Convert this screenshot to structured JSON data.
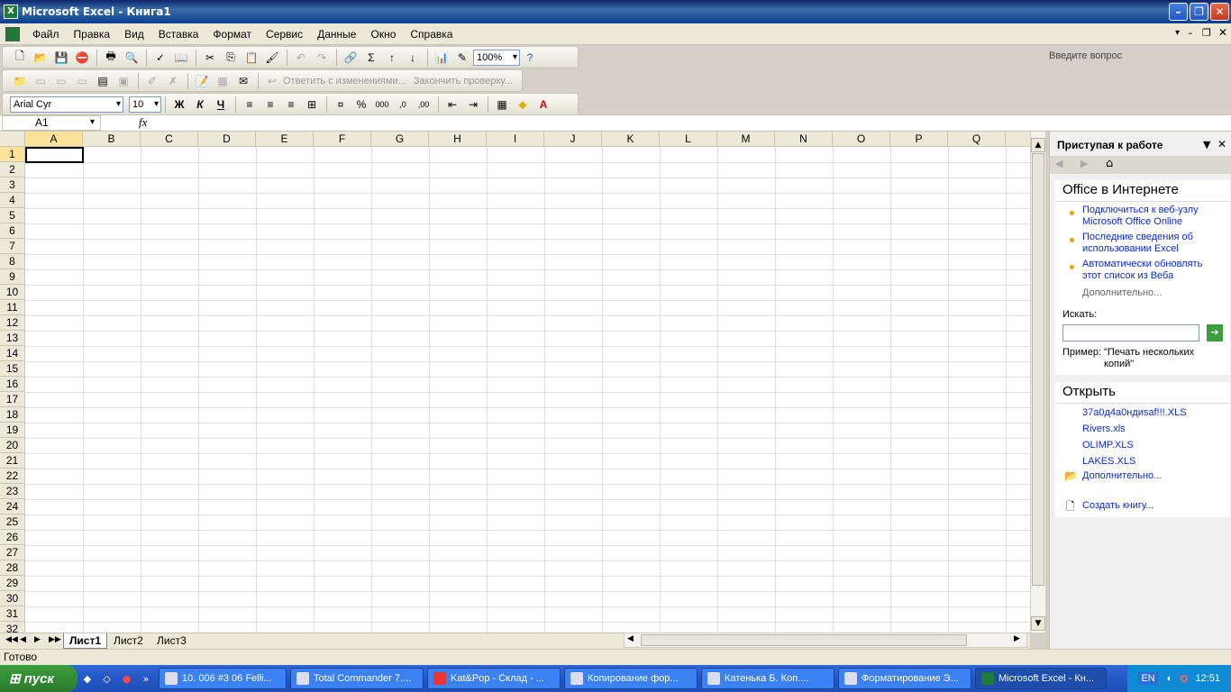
{
  "window": {
    "title": "Microsoft Excel - Книга1"
  },
  "menu": [
    "Файл",
    "Правка",
    "Вид",
    "Вставка",
    "Формат",
    "Сервис",
    "Данные",
    "Окно",
    "Справка"
  ],
  "ask_placeholder": "Введите вопрос",
  "toolbar": {
    "zoom": "100%",
    "reply_label": "Ответить с изменениями...",
    "end_review_label": "Закончить проверку...",
    "font": "Arial Cyr",
    "size": "10",
    "bold": "Ж",
    "italic": "К",
    "underline": "Ч",
    "sigma": "Σ",
    "percent": "%",
    "thousands": "000"
  },
  "namebox": "A1",
  "fx": "fx",
  "columns": [
    "A",
    "B",
    "C",
    "D",
    "E",
    "F",
    "G",
    "H",
    "I",
    "J",
    "K",
    "L",
    "M",
    "N",
    "O",
    "P",
    "Q"
  ],
  "rows": [
    "1",
    "2",
    "3",
    "4",
    "5",
    "6",
    "7",
    "8",
    "9",
    "10",
    "11",
    "12",
    "13",
    "14",
    "15",
    "16",
    "17",
    "18",
    "19",
    "20",
    "21",
    "22",
    "23",
    "24",
    "25",
    "26",
    "27",
    "28",
    "29",
    "30",
    "31",
    "32"
  ],
  "sheets": [
    "Лист1",
    "Лист2",
    "Лист3"
  ],
  "status": "Готово",
  "taskpane": {
    "title": "Приступая к работе",
    "online_header": "Office в Интернете",
    "links": [
      "Подключиться к веб-узлу Microsoft Office Online",
      "Последние сведения об использовании Excel",
      "Автоматически обновлять этот список из Веба"
    ],
    "more": "Дополнительно...",
    "search_label": "Искать:",
    "example_label": "Пример:",
    "example_text": "\"Печать нескольких копий\"",
    "open_header": "Открыть",
    "files": [
      "37a0д4a0ндиsaf!!!.XLS",
      "Rivers.xls",
      "OLIMP.XLS",
      "LAKES.XLS"
    ],
    "open_more": "Дополнительно...",
    "create": "Создать книгу..."
  },
  "taskbar": {
    "start": "пуск",
    "tasks": [
      "10. 006 #3 06 Felli...",
      "Total Commander 7....",
      "Kat&Pop - Склад - ...",
      "Копирование фор...",
      "Катенька Б. Коп....",
      "Форматирование Э...",
      "Microsoft Excel - Кн..."
    ],
    "lang": "EN",
    "clock": "12:51"
  }
}
